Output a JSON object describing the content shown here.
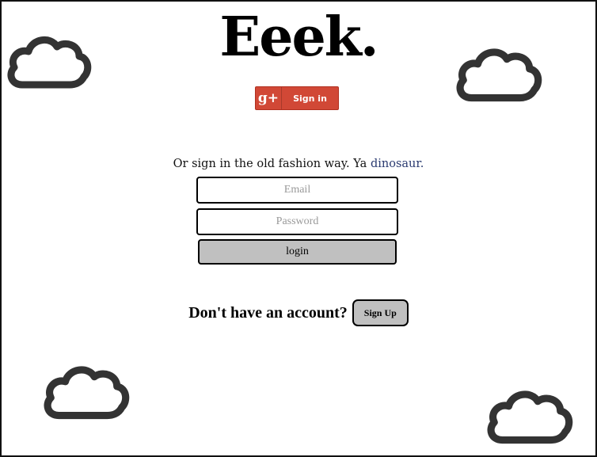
{
  "brand": {
    "logo": "Eeek."
  },
  "google_signin": {
    "icon_text": "g+",
    "label": "Sign in"
  },
  "alt_prompt": {
    "text": "Or sign in the old fashion way. Ya ",
    "highlight": "dinosaur."
  },
  "form": {
    "email_placeholder": "Email",
    "password_placeholder": "Password",
    "login_label": "login"
  },
  "signup": {
    "question": "Don't have an account?",
    "button_label": "Sign Up"
  },
  "colors": {
    "google_red": "#d14836",
    "button_gray": "#c0c0c0",
    "cloud_stroke": "#333333",
    "dinosaur_text": "#2a3a70"
  },
  "decorations": {
    "icons": [
      "cloud-icon",
      "cloud-icon",
      "cloud-icon",
      "cloud-icon"
    ]
  }
}
